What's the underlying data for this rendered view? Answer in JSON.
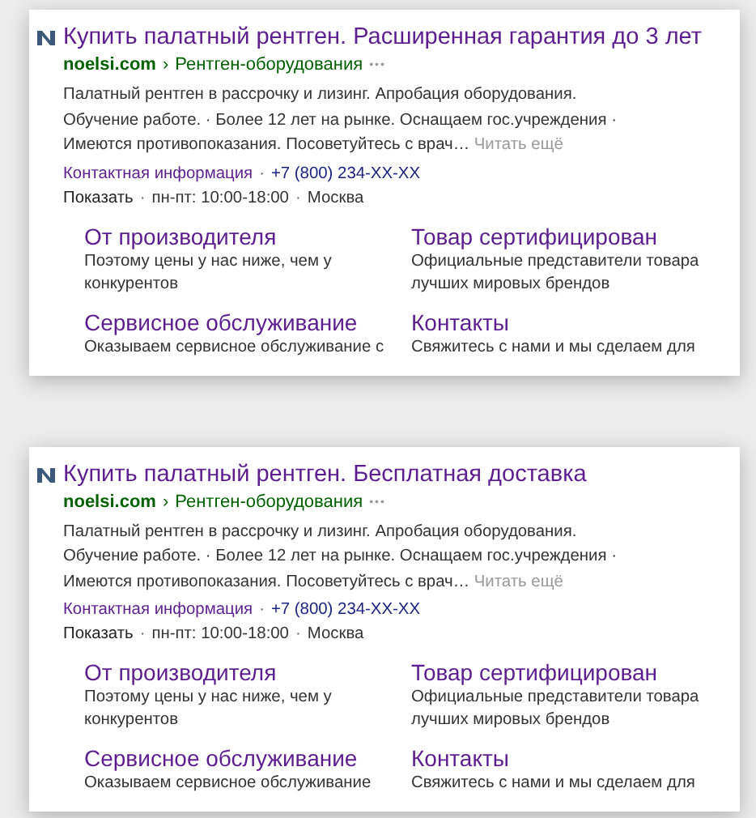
{
  "ads": [
    {
      "title": "Купить палатный рентген. Расширенная гарантия до 3 лет",
      "domain": "noelsi.com",
      "breadcrumb_arrow": "›",
      "path": "Рентген-оборудования",
      "more": "•••",
      "description": "Палатный рентген в рассрочку и лизинг. Апробация оборудования. Обучение работе. · Более 12 лет на рынке. Оснащаем гос.учреждения · Имеются противопоказания. Посоветуйтесь с врач…",
      "read_more": "Читать ещё",
      "contacts": [
        {
          "kind": "link",
          "text": "Контактная информация"
        },
        {
          "kind": "sep",
          "text": "·"
        },
        {
          "kind": "phone",
          "text": "+7 (800) 234-XX-XX"
        },
        {
          "kind": "action",
          "text": "Показать"
        },
        {
          "kind": "sep",
          "text": "·"
        },
        {
          "kind": "text",
          "text": "пн-пт: 10:00-18:00"
        },
        {
          "kind": "sep",
          "text": "·"
        },
        {
          "kind": "text",
          "text": "Москва"
        }
      ],
      "sitelinks": [
        {
          "title": "От производителя",
          "description": "Поэтому цены у нас ниже, чем у конкурентов"
        },
        {
          "title": "Товар сертифицирован",
          "description": "Официальные представители товара лучших мировых брендов"
        },
        {
          "title": "Сервисное обслуживание",
          "description": "Оказываем сервисное обслуживание с"
        },
        {
          "title": "Контакты",
          "description": "Свяжитесь с нами и мы сделаем для"
        }
      ]
    },
    {
      "title": "Купить палатный рентген. Бесплатная доставка",
      "domain": "noelsi.com",
      "breadcrumb_arrow": "›",
      "path": "Рентген-оборудования",
      "more": "•••",
      "description": "Палатный рентген в рассрочку и лизинг. Апробация оборудования. Обучение работе. · Более 12 лет на рынке. Оснащаем гос.учреждения · Имеются противопоказания. Посоветуйтесь с врач…",
      "read_more": "Читать ещё",
      "contacts": [
        {
          "kind": "link",
          "text": "Контактная информация"
        },
        {
          "kind": "sep",
          "text": "·"
        },
        {
          "kind": "phone",
          "text": "+7 (800) 234-XX-XX"
        },
        {
          "kind": "action",
          "text": "Показать"
        },
        {
          "kind": "sep",
          "text": "·"
        },
        {
          "kind": "text",
          "text": "пн-пт: 10:00-18:00"
        },
        {
          "kind": "sep",
          "text": "·"
        },
        {
          "kind": "text",
          "text": "Москва"
        }
      ],
      "sitelinks": [
        {
          "title": "От производителя",
          "description": "Поэтому цены у нас ниже, чем у конкурентов"
        },
        {
          "title": "Товар сертифицирован",
          "description": "Официальные представители товара лучших мировых брендов"
        },
        {
          "title": "Сервисное обслуживание",
          "description": "Оказываем сервисное обслуживание"
        },
        {
          "title": "Контакты",
          "description": "Свяжитесь с нами и мы сделаем для"
        }
      ]
    }
  ]
}
